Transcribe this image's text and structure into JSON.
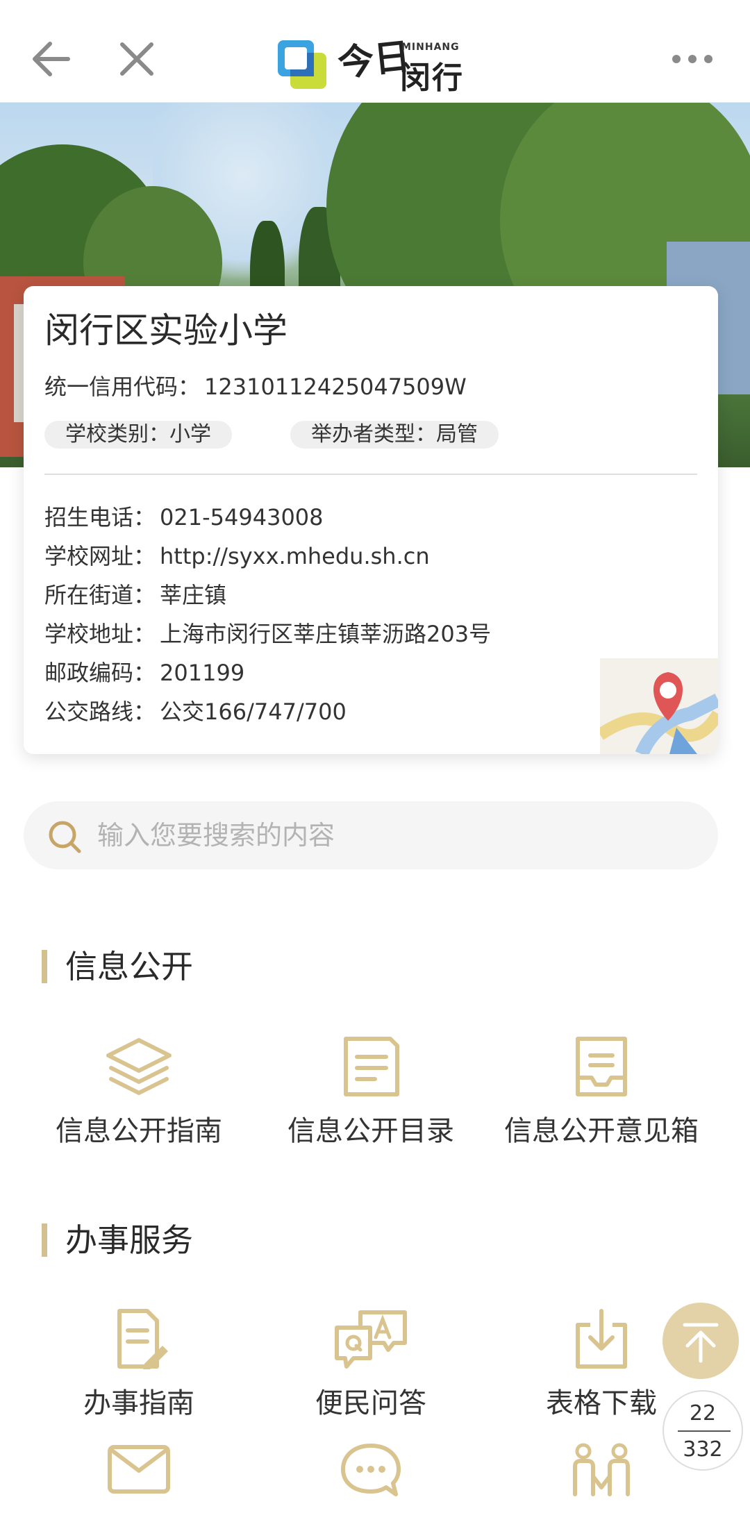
{
  "header": {
    "logo_en": "MINHANG",
    "logo_cn": "闵行",
    "logo_jin": "今日"
  },
  "school": {
    "name": "闵行区实验小学",
    "credit_label": "统一信用代码：",
    "credit_code": "12310112425047509W",
    "tags": [
      {
        "label": "学校类别：",
        "value": "小学"
      },
      {
        "label": "举办者类型：",
        "value": "局管"
      }
    ],
    "details": [
      {
        "label": "招生电话：",
        "value": "021-54943008"
      },
      {
        "label": "学校网址：",
        "value": "http://syxx.mhedu.sh.cn"
      },
      {
        "label": "所在街道：",
        "value": "莘庄镇"
      },
      {
        "label": "学校地址：",
        "value": "上海市闵行区莘庄镇莘沥路203号"
      },
      {
        "label": "邮政编码：",
        "value": "201199"
      },
      {
        "label": "公交路线：",
        "value": "公交166/747/700"
      }
    ]
  },
  "search": {
    "placeholder": "输入您要搜索的内容",
    "value": ""
  },
  "sections": [
    {
      "title": "信息公开",
      "items": [
        {
          "label": "信息公开指南",
          "icon": "layers-icon"
        },
        {
          "label": "信息公开目录",
          "icon": "document-icon"
        },
        {
          "label": "信息公开意见箱",
          "icon": "inbox-icon"
        }
      ]
    },
    {
      "title": "办事服务",
      "items": [
        {
          "label": "办事指南",
          "icon": "edit-document-icon"
        },
        {
          "label": "便民问答",
          "icon": "qa-chat-icon"
        },
        {
          "label": "表格下载",
          "icon": "download-icon"
        }
      ]
    }
  ],
  "more_icons": [
    "mail-icon",
    "chat-bubble-icon",
    "people-icon"
  ],
  "pager": {
    "current": "22",
    "total": "332"
  },
  "colors": {
    "accent": "#d3c08f",
    "icon": "#d9c48f"
  }
}
